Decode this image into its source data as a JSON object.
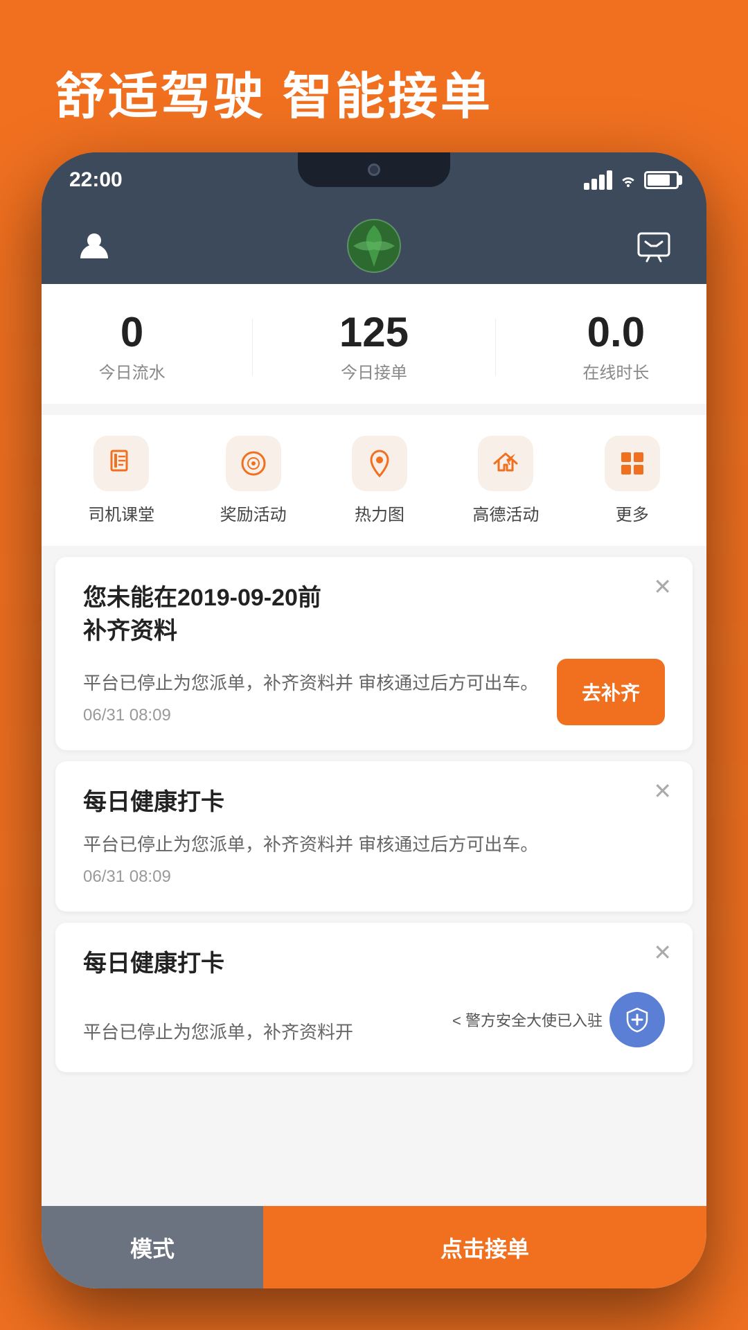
{
  "background": {
    "color": "#F07020"
  },
  "header": {
    "title": "舒适驾驶  智能接单"
  },
  "status_bar": {
    "time": "22:00",
    "signal": "full",
    "wifi": "on",
    "battery": "80"
  },
  "app_header": {
    "logo_alt": "app-logo"
  },
  "stats": [
    {
      "value": "0",
      "label": "今日流水"
    },
    {
      "value": "125",
      "label": "今日接单"
    },
    {
      "value": "0.0",
      "label": "在线时长"
    }
  ],
  "menu_items": [
    {
      "id": "driver-class",
      "label": "司机课堂",
      "icon": "book"
    },
    {
      "id": "rewards",
      "label": "奖励活动",
      "icon": "target"
    },
    {
      "id": "heatmap",
      "label": "热力图",
      "icon": "location"
    },
    {
      "id": "amap",
      "label": "高德活动",
      "icon": "plane"
    },
    {
      "id": "more",
      "label": "更多",
      "icon": "grid"
    }
  ],
  "cards": [
    {
      "id": "card-1",
      "title": "您未能在2019-09-20前\n补齐资料",
      "desc": "平台已停止为您派单，补齐资料并\n审核通过后方可出车。",
      "time": "06/31 08:09",
      "action_label": "去补齐",
      "has_action": true
    },
    {
      "id": "card-2",
      "title": "每日健康打卡",
      "desc": "平台已停止为您派单，补齐资料并\n审核通过后方可出车。",
      "time": "06/31 08:09",
      "has_action": false
    },
    {
      "id": "card-3",
      "title": "每日健康打卡",
      "desc": "平台已停止为您派单，补齐资料开",
      "time": "",
      "has_action": false
    }
  ],
  "security_notice": "< 警方安全大使已入驻",
  "bottom_bar": {
    "mode_label": "模式",
    "accept_label": "点击接单"
  }
}
